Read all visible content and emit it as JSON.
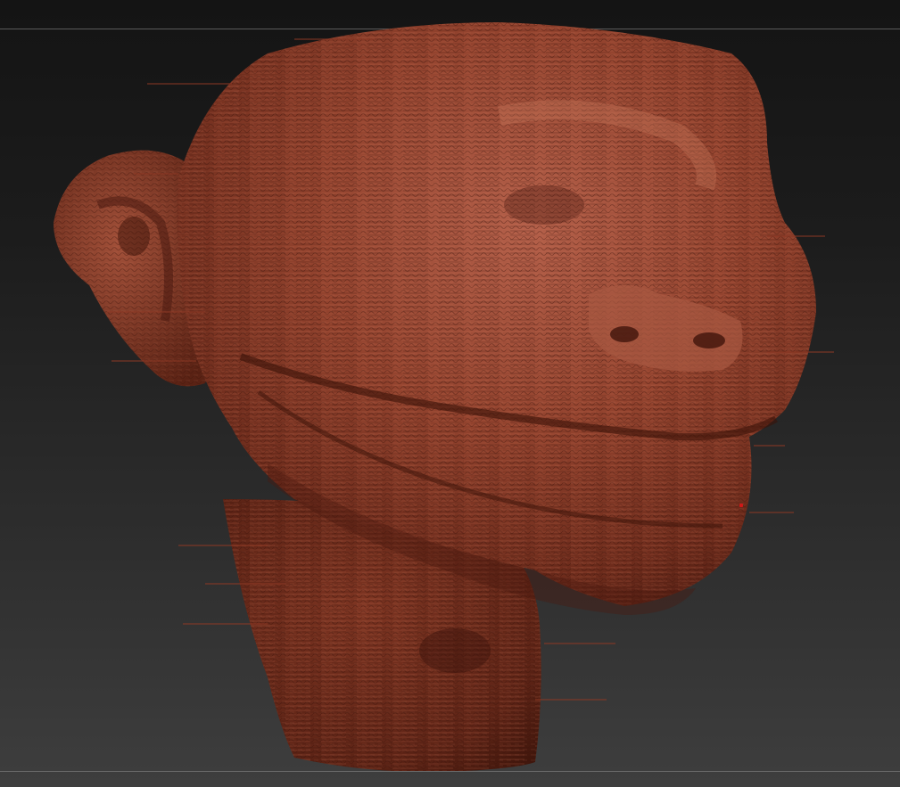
{
  "viewport": {
    "background_top": "#141414",
    "background_bottom": "#3e3e3e"
  },
  "model": {
    "material_color": "#8a3a28",
    "highlight_color": "#b5604a",
    "shadow_color": "#4a1a10",
    "icon": "sculpted-head-mesh"
  },
  "colors": {
    "cursor": "#d01818",
    "guide_line": "#5a5a5a"
  }
}
